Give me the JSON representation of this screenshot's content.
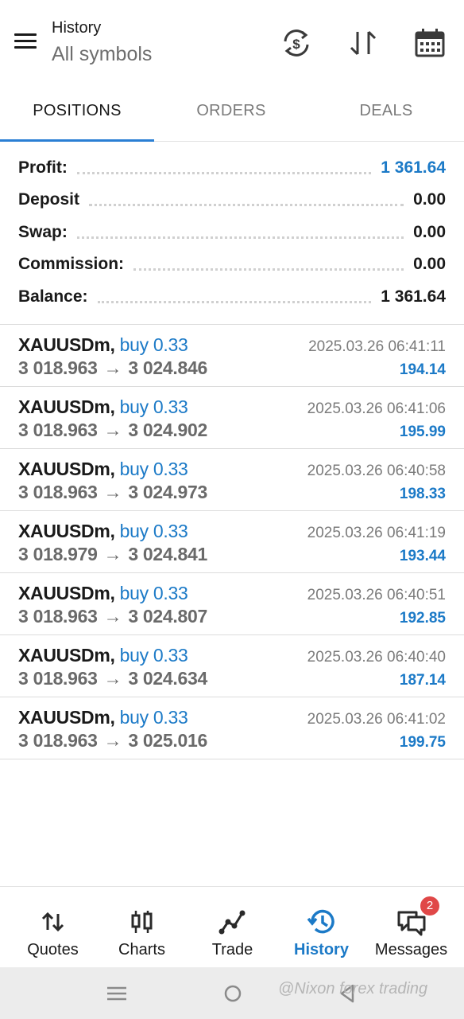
{
  "header": {
    "title": "History",
    "subtitle": "All symbols",
    "icons": [
      "menu-icon",
      "sync-currency-icon",
      "sort-icon",
      "calendar-icon"
    ]
  },
  "tabs": [
    {
      "label": "POSITIONS",
      "active": true
    },
    {
      "label": "ORDERS",
      "active": false
    },
    {
      "label": "DEALS",
      "active": false
    }
  ],
  "summary": {
    "profit_label": "Profit:",
    "profit_value": "1 361.64",
    "deposit_label": "Deposit",
    "deposit_value": "0.00",
    "swap_label": "Swap:",
    "swap_value": "0.00",
    "commission_label": "Commission:",
    "commission_value": "0.00",
    "balance_label": "Balance:",
    "balance_value": "1 361.64"
  },
  "positions": [
    {
      "symbol": "XAUUSDm,",
      "side": "buy 0.33",
      "open": "3 018.963",
      "arrow": "→",
      "close": "3 024.846",
      "time": "2025.03.26 06:41:11",
      "profit": "194.14"
    },
    {
      "symbol": "XAUUSDm,",
      "side": "buy 0.33",
      "open": "3 018.963",
      "arrow": "→",
      "close": "3 024.902",
      "time": "2025.03.26 06:41:06",
      "profit": "195.99"
    },
    {
      "symbol": "XAUUSDm,",
      "side": "buy 0.33",
      "open": "3 018.963",
      "arrow": "→",
      "close": "3 024.973",
      "time": "2025.03.26 06:40:58",
      "profit": "198.33"
    },
    {
      "symbol": "XAUUSDm,",
      "side": "buy 0.33",
      "open": "3 018.979",
      "arrow": "→",
      "close": "3 024.841",
      "time": "2025.03.26 06:41:19",
      "profit": "193.44"
    },
    {
      "symbol": "XAUUSDm,",
      "side": "buy 0.33",
      "open": "3 018.963",
      "arrow": "→",
      "close": "3 024.807",
      "time": "2025.03.26 06:40:51",
      "profit": "192.85"
    },
    {
      "symbol": "XAUUSDm,",
      "side": "buy 0.33",
      "open": "3 018.963",
      "arrow": "→",
      "close": "3 024.634",
      "time": "2025.03.26 06:40:40",
      "profit": "187.14"
    },
    {
      "symbol": "XAUUSDm,",
      "side": "buy 0.33",
      "open": "3 018.963",
      "arrow": "→",
      "close": "3 025.016",
      "time": "2025.03.26 06:41:02",
      "profit": "199.75"
    }
  ],
  "bottom_nav": [
    {
      "label": "Quotes",
      "icon": "quotes-icon",
      "active": false
    },
    {
      "label": "Charts",
      "icon": "charts-icon",
      "active": false
    },
    {
      "label": "Trade",
      "icon": "trade-icon",
      "active": false
    },
    {
      "label": "History",
      "icon": "history-icon",
      "active": true
    },
    {
      "label": "Messages",
      "icon": "messages-icon",
      "active": false,
      "badge": "2"
    }
  ],
  "watermark": "@Nixon forex trading",
  "colors": {
    "accent": "#1c7ac7",
    "tab_underline": "#2a7fd4",
    "badge": "#e04848"
  }
}
